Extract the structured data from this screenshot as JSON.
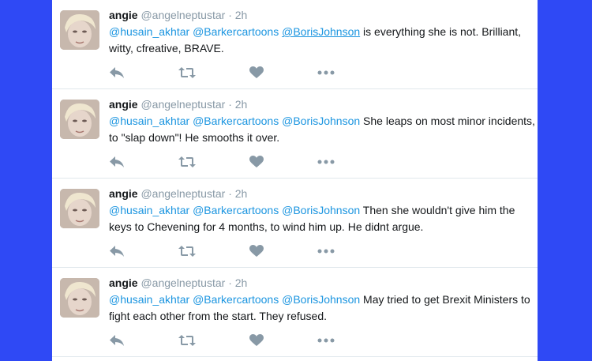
{
  "tweets": [
    {
      "name": "angie",
      "handle": "@angelneptustar",
      "dot": "·",
      "time": "2h",
      "mentions": [
        "@husain_akhtar",
        "@Barkercartoons",
        "@BorisJohnson"
      ],
      "text": "is everything she is not. Brilliant, witty, cfreative, BRAVE."
    },
    {
      "name": "angie",
      "handle": "@angelneptustar",
      "dot": "·",
      "time": "2h",
      "mentions": [
        "@husain_akhtar",
        "@Barkercartoons",
        "@BorisJohnson"
      ],
      "text": "She leaps on most minor incidents, to \"slap down\"!  He smooths it over."
    },
    {
      "name": "angie",
      "handle": "@angelneptustar",
      "dot": "·",
      "time": "2h",
      "mentions": [
        "@husain_akhtar",
        "@Barkercartoons",
        "@BorisJohnson"
      ],
      "text": "Then she wouldn't give him the keys to Chevening for 4 months, to wind him up.  He didnt argue."
    },
    {
      "name": "angie",
      "handle": "@angelneptustar",
      "dot": "·",
      "time": "2h",
      "mentions": [
        "@husain_akhtar",
        "@Barkercartoons",
        "@BorisJohnson"
      ],
      "text": "May tried to get Brexit Ministers to fight each other from the start.  They refused."
    }
  ],
  "icons": {
    "reply": "reply-icon",
    "retweet": "retweet-icon",
    "like": "heart-icon",
    "more": "more-icon"
  },
  "colors": {
    "background": "#2f49f5",
    "card": "#ffffff",
    "mention": "#1b95e0",
    "meta": "#8899a6",
    "icon": "#8899a6"
  }
}
